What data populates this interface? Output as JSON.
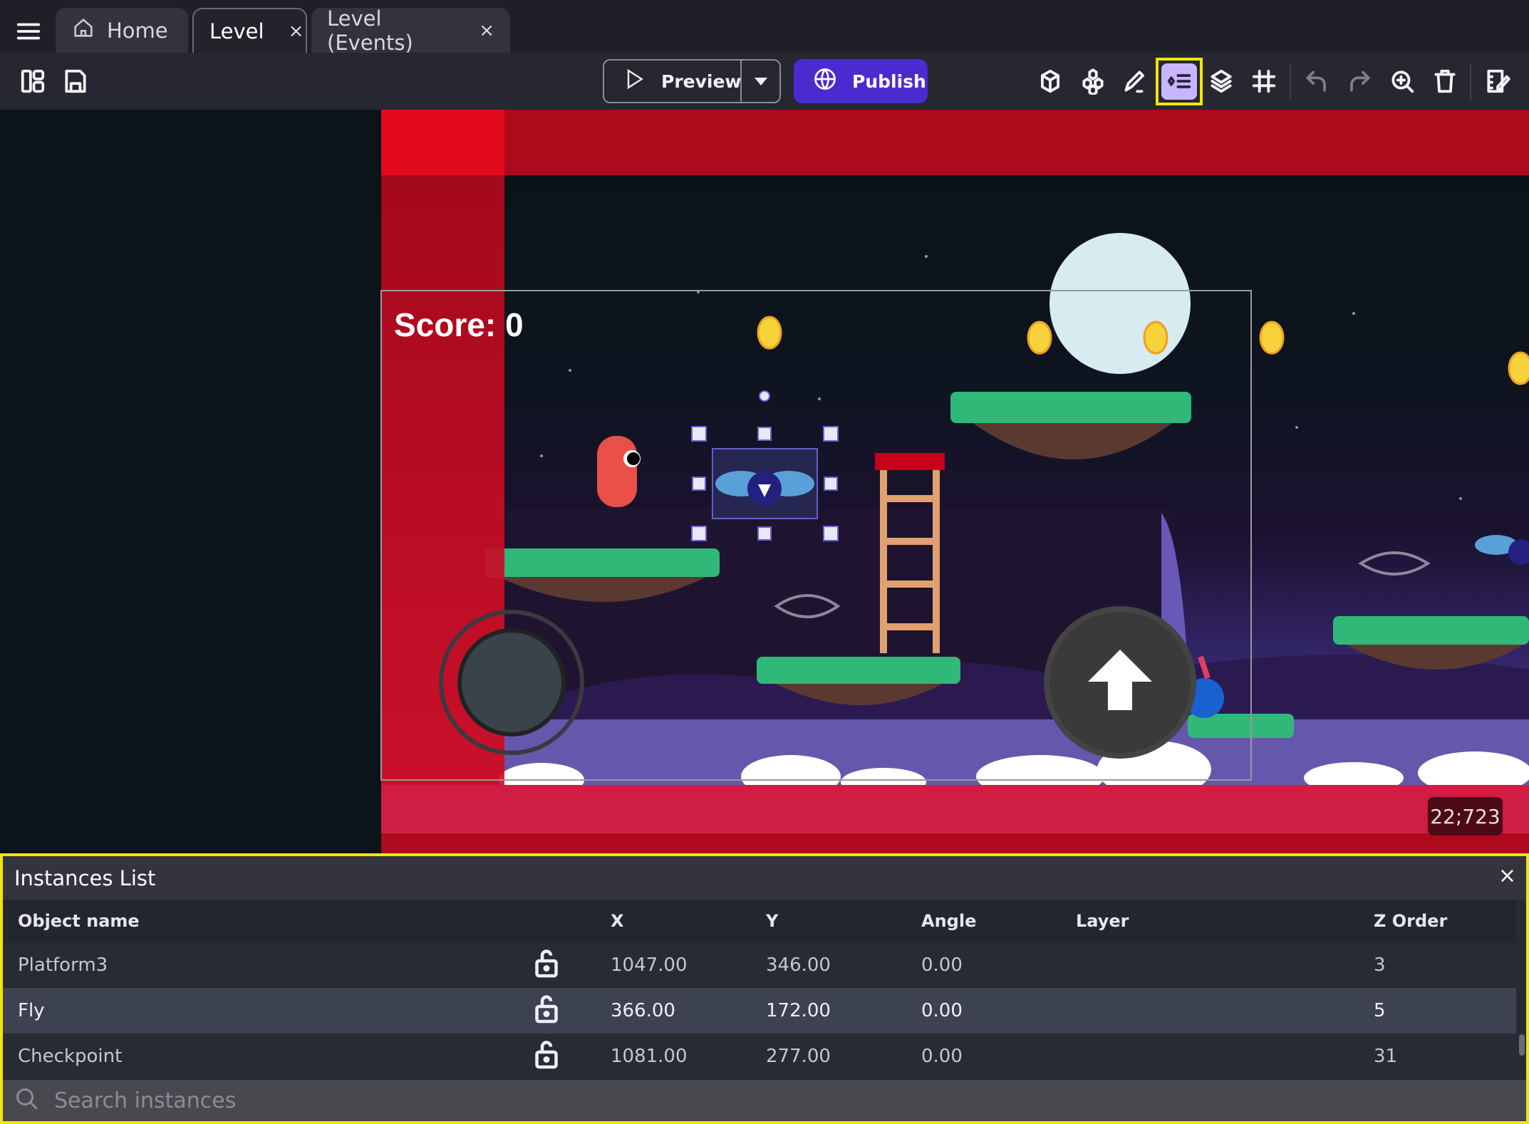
{
  "tabs": {
    "menu_icon": "hamburger-icon",
    "items": [
      {
        "label": "Home",
        "icon": "home-icon"
      },
      {
        "label": "Level",
        "active": true,
        "close": "×"
      },
      {
        "label": "Level (Events)",
        "close": "×"
      }
    ]
  },
  "toolbar": {
    "preview_label": "Preview",
    "publish_label": "Publish",
    "highlighted_tool": "instances-list",
    "accent": "#4b2bd0",
    "icons_left": [
      "panels-icon",
      "save-icon"
    ],
    "icons_right": [
      "object-icon",
      "object-groups-icon",
      "properties-icon",
      "instances-list-icon",
      "layers-icon",
      "grid-icon",
      "undo-icon",
      "redo-icon",
      "zoom-icon",
      "delete-icon",
      "edit-scene-icon"
    ]
  },
  "canvas": {
    "score_text": "Score: 0",
    "coords": "22;723"
  },
  "instances": {
    "title": "Instances List",
    "close": "×",
    "columns": [
      "Object name",
      "",
      "X",
      "Y",
      "Angle",
      "Layer",
      "Z Order"
    ],
    "rows": [
      {
        "name": "Platform3",
        "locked": false,
        "x": "1047.00",
        "y": "346.00",
        "angle": "0.00",
        "layer": "",
        "z": "3"
      },
      {
        "name": "Fly",
        "locked": false,
        "x": "366.00",
        "y": "172.00",
        "angle": "0.00",
        "layer": "",
        "z": "5",
        "selected": true
      },
      {
        "name": "Checkpoint",
        "locked": false,
        "x": "1081.00",
        "y": "277.00",
        "angle": "0.00",
        "layer": "",
        "z": "31"
      }
    ],
    "search_placeholder": "Search instances"
  }
}
